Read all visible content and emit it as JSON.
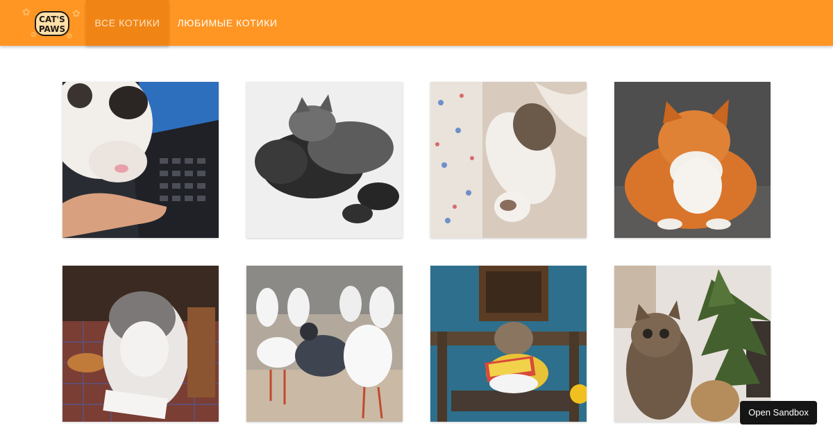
{
  "app": {
    "logo_text_line1": "CAT'S",
    "logo_text_line2": "PAWS"
  },
  "nav": {
    "tabs": [
      {
        "label": "Все котики",
        "active": true
      },
      {
        "label": "Любимые котики",
        "active": false
      }
    ]
  },
  "gallery": {
    "cards": [
      {
        "alt": "cat-on-laptop"
      },
      {
        "alt": "sleeping-kittens"
      },
      {
        "alt": "cat-on-bed"
      },
      {
        "alt": "ginger-cat"
      },
      {
        "alt": "fluffy-grey-cat"
      },
      {
        "alt": "seagulls-and-pigeon"
      },
      {
        "alt": "cat-on-bench"
      },
      {
        "alt": "cats-and-tree"
      }
    ]
  },
  "sandbox": {
    "label": "Open Sandbox"
  },
  "colors": {
    "header_bg": "#ff9623",
    "active_tab_bg": "#f08515"
  }
}
